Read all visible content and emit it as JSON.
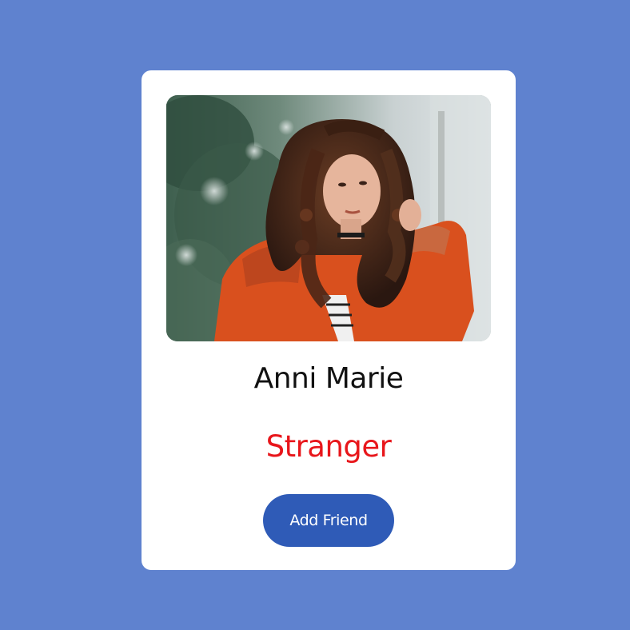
{
  "profile": {
    "name": "Anni Marie",
    "status": "Stranger",
    "add_friend_label": "Add Friend",
    "photo_icon": "profile-photo"
  },
  "colors": {
    "background": "#5f82cf",
    "card": "#ffffff",
    "status": "#e8161b",
    "button": "#2f5bb7",
    "button_text": "#ffffff"
  }
}
